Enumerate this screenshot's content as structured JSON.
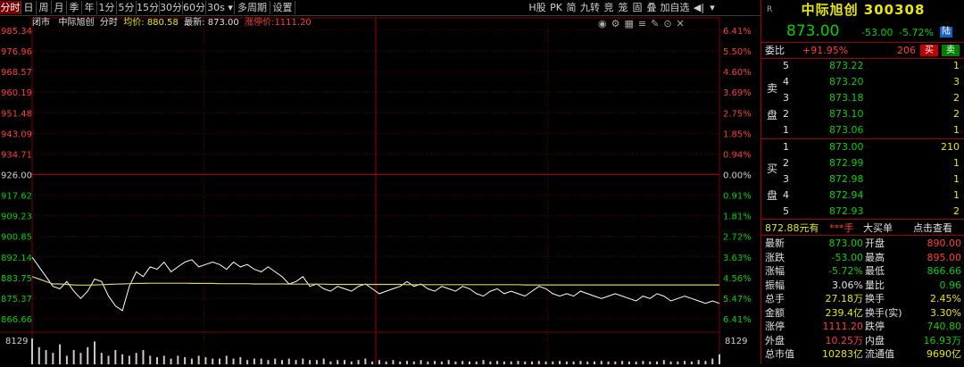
{
  "toolbar": {
    "tabs": [
      "分时",
      "日",
      "周",
      "月",
      "季",
      "年",
      "1分",
      "5分",
      "15分",
      "30分",
      "60分",
      "30s ▾",
      "多周期",
      "设置"
    ],
    "right": [
      "H股",
      "PK",
      "简",
      "九转",
      "竞",
      "笼",
      "固",
      "叠",
      "加自选",
      "◀|",
      "▾"
    ]
  },
  "stock_line": {
    "status": "闭市",
    "name": "中际旭创",
    "mode": "分时",
    "avg_label": "均价: 880.58",
    "last_label": "最新: 873.00",
    "limit_label": "涨停价:1111.20"
  },
  "axes": {
    "left": [
      "985.34",
      "976.96",
      "968.57",
      "960.19",
      "951.48",
      "943.09",
      "934.71",
      "926.00",
      "917.62",
      "909.23",
      "900.85",
      "892.14",
      "883.75",
      "875.37",
      "866.66"
    ],
    "right": [
      "6.41%",
      "5.50%",
      "4.60%",
      "3.69%",
      "2.75%",
      "1.85%",
      "0.94%",
      "0.00%",
      "0.91%",
      "1.81%",
      "2.72%",
      "3.63%",
      "4.56%",
      "5.47%",
      "6.41%"
    ],
    "vol_left": "8129",
    "vol_right": "8129"
  },
  "chart_data": {
    "type": "line",
    "title": "",
    "xlabel": "",
    "ylabel": "",
    "ylim": [
      866.66,
      985.34
    ],
    "prev_close": 926.0,
    "series": [
      {
        "color": "#ffffff",
        "values": [
          892,
          888,
          884,
          880,
          879,
          882,
          878,
          875,
          878,
          883,
          882,
          876,
          872,
          870,
          880,
          886,
          884,
          888,
          887,
          890,
          886,
          888,
          890,
          891,
          888,
          889,
          890,
          889,
          887,
          890,
          888,
          889,
          887,
          886,
          888,
          886,
          884,
          881,
          882,
          884,
          880,
          881,
          879,
          878,
          880,
          879,
          878,
          880,
          881,
          879,
          877,
          878,
          879,
          880,
          882,
          880,
          881,
          879,
          878,
          880,
          879,
          878,
          880,
          879,
          877,
          876,
          878,
          879,
          877,
          878,
          877,
          876,
          878,
          880,
          879,
          877,
          876,
          877,
          876,
          878,
          877,
          876,
          875,
          876,
          877,
          876,
          875,
          874,
          876,
          875,
          877,
          876,
          874,
          875,
          876,
          875,
          874,
          873,
          874,
          873
        ]
      },
      {
        "color": "#d8d060",
        "values": [
          884,
          883,
          882,
          881,
          881,
          880.8,
          880.6,
          880.5,
          880.5,
          880.6,
          880.7,
          880.8,
          880.9,
          881,
          881.1,
          881.2,
          881.2,
          881.3,
          881.3,
          881.3,
          881.3,
          881.3,
          881.3,
          881.2,
          881.2,
          881.2,
          881.2,
          881.1,
          881.1,
          881.1,
          881.1,
          881.1,
          881,
          881,
          881,
          881,
          881,
          880.9,
          880.9,
          880.9,
          880.9,
          880.9,
          880.9,
          880.8,
          880.8,
          880.8,
          880.8,
          880.8,
          880.8,
          880.8,
          880.8,
          880.8,
          880.8,
          880.8,
          880.7,
          880.7,
          880.7,
          880.7,
          880.7,
          880.7,
          880.7,
          880.7,
          880.7,
          880.7,
          880.7,
          880.7,
          880.7,
          880.7,
          880.7,
          880.7,
          880.7,
          880.6,
          880.6,
          880.6,
          880.6,
          880.6,
          880.6,
          880.6,
          880.6,
          880.6,
          880.6,
          880.6,
          880.6,
          880.6,
          880.6,
          880.6,
          880.6,
          880.6,
          880.6,
          880.6,
          880.6,
          880.6,
          880.6,
          880.6,
          880.6,
          880.6,
          880.6,
          880.6,
          880.6,
          880.58
        ]
      }
    ],
    "volumes": [
      0.9,
      0.6,
      0.5,
      0.4,
      0.7,
      0.3,
      0.5,
      0.4,
      0.6,
      0.8,
      0.4,
      0.3,
      0.5,
      0.35,
      0.3,
      0.4,
      0.5,
      0.3,
      0.25,
      0.3,
      0.2,
      0.3,
      0.25,
      0.2,
      0.3,
      0.25,
      0.2,
      0.2,
      0.3,
      0.2,
      0.25,
      0.15,
      0.2,
      0.2,
      0.15,
      0.2,
      0.15,
      0.2,
      0.15,
      0.2,
      0.15,
      0.15,
      0.2,
      0.1,
      0.15,
      0.15,
      0.1,
      0.15,
      0.2,
      0.1,
      0.15,
      0.1,
      0.15,
      0.1,
      0.12,
      0.1,
      0.15,
      0.1,
      0.12,
      0.1,
      0.15,
      0.1,
      0.12,
      0.1,
      0.1,
      0.15,
      0.1,
      0.12,
      0.1,
      0.1,
      0.12,
      0.1,
      0.1,
      0.12,
      0.1,
      0.1,
      0.12,
      0.1,
      0.1,
      0.12,
      0.1,
      0.1,
      0.12,
      0.1,
      0.1,
      0.12,
      0.1,
      0.1,
      0.12,
      0.1,
      0.1,
      0.15,
      0.1,
      0.1,
      0.12,
      0.1,
      0.15,
      0.12,
      0.2,
      0.35
    ]
  },
  "panel": {
    "title": "中际旭创 300308",
    "r_mark": "R",
    "price": "873.00",
    "change": "-53.00",
    "pct": "-5.72%",
    "exch": "陆",
    "weibi_label": "委比",
    "weibi_val": "+91.95%",
    "weicha": "206",
    "buy_btn": "买",
    "sell_btn": "卖",
    "sell_label": "卖盘",
    "sells": [
      {
        "lvl": "5",
        "price": "873.22",
        "vol": "1"
      },
      {
        "lvl": "4",
        "price": "873.20",
        "vol": "3"
      },
      {
        "lvl": "3",
        "price": "873.18",
        "vol": "2"
      },
      {
        "lvl": "2",
        "price": "873.10",
        "vent": "",
        "vol": "2"
      },
      {
        "lvl": "1",
        "price": "873.06",
        "vol": "1"
      }
    ],
    "buy_label": "买盘",
    "buys": [
      {
        "lvl": "1",
        "price": "873.00",
        "vol": "210"
      },
      {
        "lvl": "2",
        "price": "872.99",
        "vol": "1"
      },
      {
        "lvl": "3",
        "price": "872.98",
        "vol": "1"
      },
      {
        "lvl": "4",
        "price": "872.94",
        "vol": "1"
      },
      {
        "lvl": "5",
        "price": "872.93",
        "vol": "2"
      }
    ],
    "bigorder": {
      "a": "872.88元有",
      "b": "***手",
      "c": "大买单",
      "d": "点击查看"
    },
    "stats": [
      {
        "l1": "最新",
        "v1": "873.00",
        "l2": "开盘",
        "v2": "890.00",
        "c1": "grn",
        "c2": "red"
      },
      {
        "l1": "涨跌",
        "v1": "-53.00",
        "l2": "最高",
        "v2": "895.00",
        "c1": "grn",
        "c2": "red"
      },
      {
        "l1": "涨幅",
        "v1": "-5.72%",
        "l2": "最低",
        "v2": "866.66",
        "c1": "grn",
        "c2": "grn"
      },
      {
        "l1": "振幅",
        "v1": "3.06%",
        "l2": "量比",
        "v2": "0.96",
        "c1": "wht",
        "c2": "grn"
      },
      {
        "l1": "总手",
        "v1": "27.18万",
        "l2": "换手",
        "v2": "2.45%",
        "c1": "yel",
        "c2": "yel"
      },
      {
        "l1": "金额",
        "v1": "239.4亿",
        "l2": "换手(实)",
        "v2": "3.30%",
        "c1": "yel",
        "c2": "yel"
      },
      {
        "l1": "涨停",
        "v1": "1111.20",
        "l2": "跌停",
        "v2": "740.80",
        "c1": "red",
        "c2": "grn"
      },
      {
        "l1": "外盘",
        "v1": "10.25万",
        "l2": "内盘",
        "v2": "16.93万",
        "c1": "red",
        "c2": "grn"
      },
      {
        "l1": "总市值",
        "v1": "10283亿",
        "l2": "流通值",
        "v2": "9690亿",
        "c1": "yel",
        "c2": "yel"
      }
    ]
  },
  "colors": {
    "up": "#ff3b3b",
    "down": "#00d000",
    "grid": "#7a0000",
    "accent": "#e8e800"
  }
}
